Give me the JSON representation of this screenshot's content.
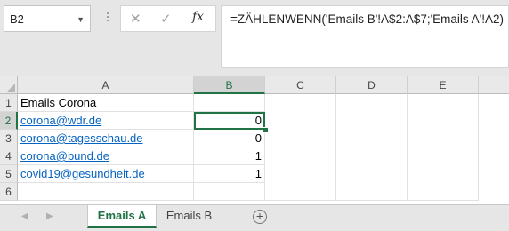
{
  "formula_bar": {
    "name_box": "B2",
    "cancel_icon": "✕",
    "enter_icon": "✓",
    "fx_label": "fx",
    "formula": "=ZÄHLENWENN('Emails B'!A$2:A$7;'Emails A'!A2)"
  },
  "columns": [
    "A",
    "B",
    "C",
    "D",
    "E"
  ],
  "rows": [
    {
      "num": "1",
      "a": "Emails Corona",
      "b": ""
    },
    {
      "num": "2",
      "a": "corona@wdr.de",
      "b": "0"
    },
    {
      "num": "3",
      "a": "corona@tagesschau.de",
      "b": "0"
    },
    {
      "num": "4",
      "a": "corona@bund.de",
      "b": "1"
    },
    {
      "num": "5",
      "a": "covid19@gesundheit.de",
      "b": "1"
    },
    {
      "num": "6",
      "a": "",
      "b": ""
    }
  ],
  "sheet_tabs": [
    "Emails A",
    "Emails B"
  ],
  "active_sheet": "Emails A",
  "accent_color": "#217346",
  "link_color": "#0563c1"
}
